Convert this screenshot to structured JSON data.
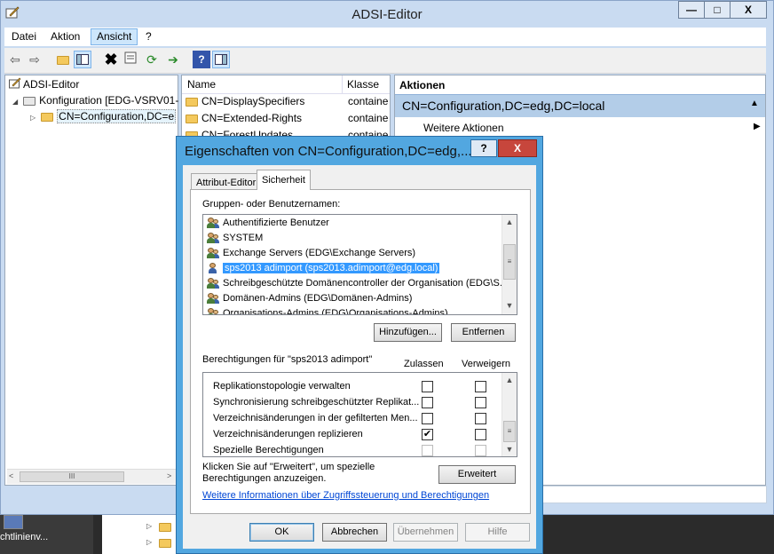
{
  "window": {
    "title": "ADSI-Editor",
    "controls": {
      "minimize": "—",
      "maximize": "□",
      "close": "X"
    }
  },
  "menubar": [
    "Datei",
    "Aktion",
    "Ansicht",
    "?"
  ],
  "tree": {
    "root": "ADSI-Editor",
    "child": "Konfiguration [EDG-VSRV01-",
    "grandchild": "CN=Configuration,DC=e"
  },
  "list": {
    "headers": {
      "name": "Name",
      "class": "Klasse"
    },
    "rows": [
      {
        "name": "CN=DisplaySpecifiers",
        "class": "container"
      },
      {
        "name": "CN=Extended-Rights",
        "class": "container"
      },
      {
        "name": "CN=ForestUpdates",
        "class": "container"
      }
    ]
  },
  "actions": {
    "header": "Aktionen",
    "context": "CN=Configuration,DC=edg,DC=local",
    "more": "Weitere Aktionen"
  },
  "dialog": {
    "title": "Eigenschaften von CN=Configuration,DC=edg,...",
    "help": "?",
    "close": "X",
    "tabs": [
      "Attribut-Editor",
      "Sicherheit"
    ],
    "groups_label": "Gruppen- oder Benutzernamen:",
    "users": [
      "Authentifizierte Benutzer",
      "SYSTEM",
      "Exchange Servers (EDG\\Exchange Servers)",
      "sps2013 adimport (sps2013.adimport@edg.local)",
      "Schreibgeschützte Domänencontroller der Organisation (EDG\\S...",
      "Domänen-Admins (EDG\\Domänen-Admins)",
      "Organisations-Admins (EDG\\Organisations-Admins)"
    ],
    "add_button": "Hinzufügen...",
    "remove_button": "Entfernen",
    "perm_label": "Berechtigungen für \"sps2013 adimport\"",
    "allow_header": "Zulassen",
    "deny_header": "Verweigern",
    "permissions": [
      {
        "name": "Replikationstopologie verwalten",
        "allow": false,
        "deny": false
      },
      {
        "name": "Synchronisierung schreibgeschützter Replikat...",
        "allow": false,
        "deny": false
      },
      {
        "name": "Verzeichnisänderungen in der gefilterten Men...",
        "allow": false,
        "deny": false
      },
      {
        "name": "Verzeichnisänderungen replizieren",
        "allow": true,
        "deny": false
      },
      {
        "name": "Spezielle Berechtigungen",
        "allow": false,
        "deny": false
      }
    ],
    "special_text": "Klicken Sie auf \"Erweitert\", um spezielle Berechtigungen anzuzeigen.",
    "advanced_button": "Erweitert",
    "more_info_link": "Weitere Informationen über Zugriffssteuerung und Berechtigungen",
    "ok_button": "OK",
    "cancel_button": "Abbrechen",
    "apply_button": "Übernehmen",
    "help_button": "Hilfe"
  },
  "taskbar": {
    "item": "chtlinienv..."
  },
  "colors": {
    "selection": "#3399ff",
    "dialog_frame": "#52a7e0",
    "window_frame": "#c9dbf1"
  }
}
